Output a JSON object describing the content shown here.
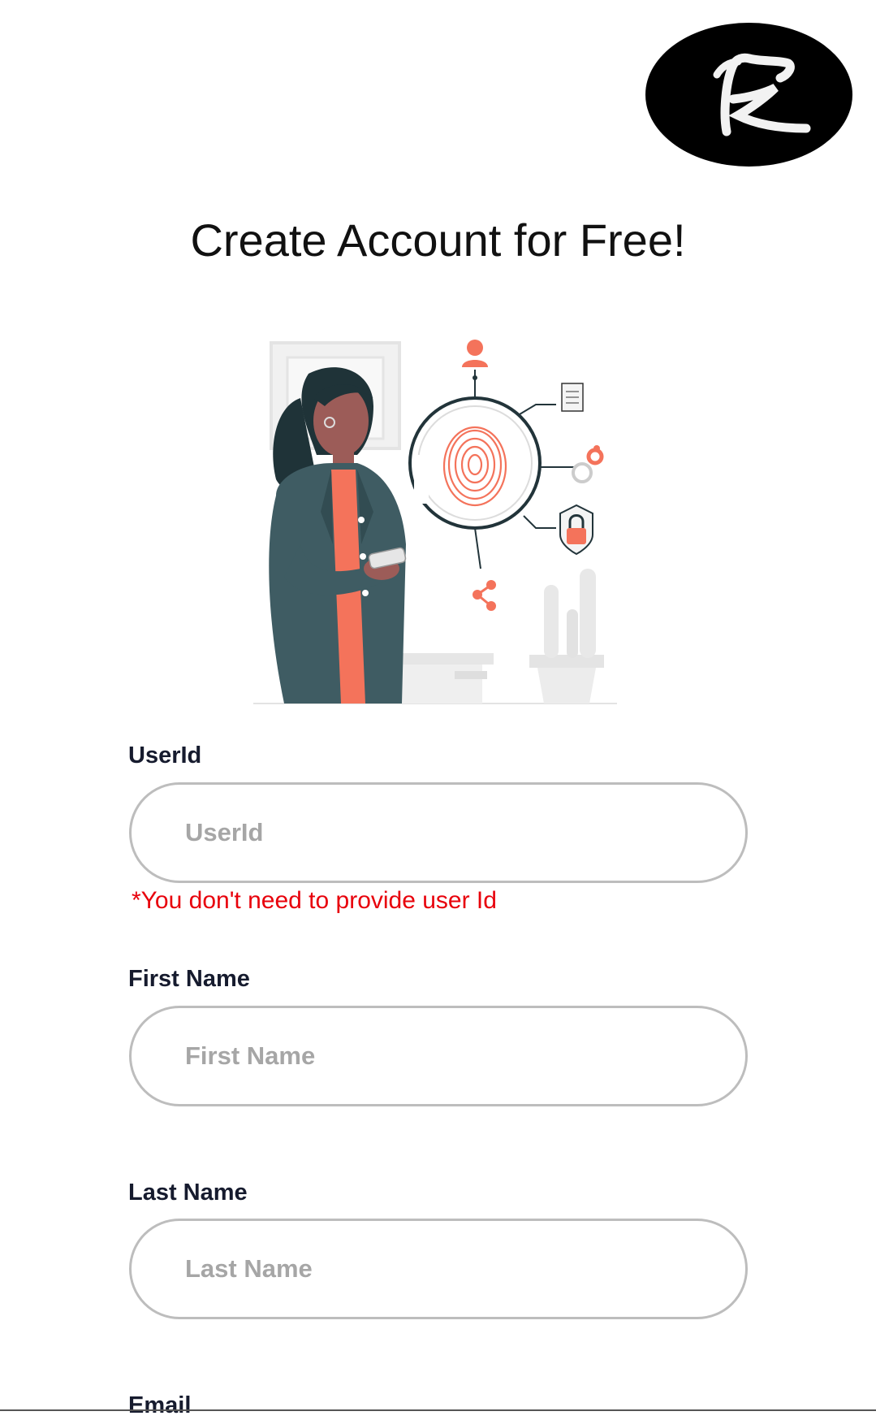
{
  "header": {
    "logo_letter": "R"
  },
  "page": {
    "title": "Create Account for Free!"
  },
  "form": {
    "userid": {
      "label": "UserId",
      "placeholder": "UserId",
      "value": "",
      "hint": "*You don't need to provide user Id"
    },
    "first_name": {
      "label": "First Name",
      "placeholder": "First Name",
      "value": ""
    },
    "last_name": {
      "label": "Last Name",
      "placeholder": "Last Name",
      "value": ""
    },
    "email": {
      "label": "Email"
    }
  },
  "colors": {
    "accent": "#f4735b",
    "error": "#e8000b",
    "label": "#161b2e",
    "input_border": "#bdbdbd",
    "placeholder": "#a6a6a6"
  },
  "icons": {
    "illustration": "woman-fingerprint-security-illustration",
    "logo": "rk-signature-logo"
  }
}
